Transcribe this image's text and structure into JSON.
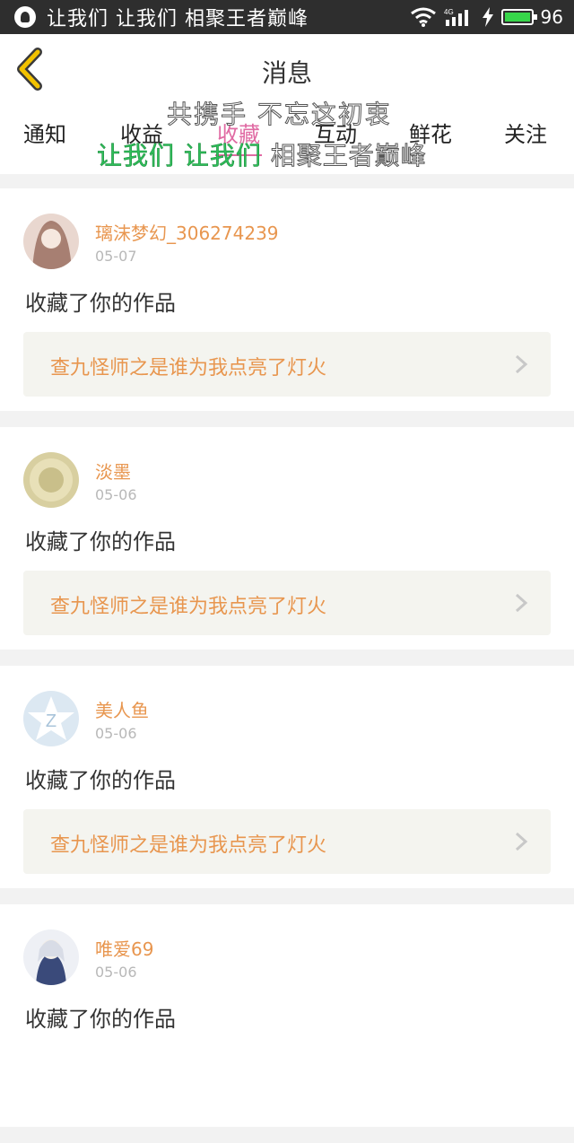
{
  "status_bar": {
    "carrier": "让我们 让我们 相聚王者巅峰",
    "battery_level": "96",
    "network": "4G",
    "colors": {
      "background": "#2e2e2e",
      "battery": "#37d64a"
    }
  },
  "header": {
    "title": "消息",
    "back_icon": "chevron-left-icon",
    "accent": "#f2c200"
  },
  "tabs": [
    {
      "label": "通知",
      "active": false
    },
    {
      "label": "收益",
      "active": false
    },
    {
      "label": "收藏",
      "active": true
    },
    {
      "label": "互动",
      "active": false
    },
    {
      "label": "鲜花",
      "active": false
    },
    {
      "label": "关注",
      "active": false
    }
  ],
  "watermark": {
    "line1": "共携手 不忘这初衷",
    "line2_green": "让我们 让我们",
    "line2_white": " 相聚王者巅峰"
  },
  "messages": [
    {
      "username": "璃沫梦幻_306274239",
      "date": "05-07",
      "action": "收藏了你的作品",
      "work_title": "查九怪师之是谁为我点亮了灯火"
    },
    {
      "username": "淡墨",
      "date": "05-06",
      "action": "收藏了你的作品",
      "work_title": "查九怪师之是谁为我点亮了灯火"
    },
    {
      "username": "美人鱼",
      "date": "05-06",
      "action": "收藏了你的作品",
      "work_title": "查九怪师之是谁为我点亮了灯火"
    },
    {
      "username": "唯爱69",
      "date": "05-06",
      "action": "收藏了你的作品",
      "work_title": ""
    }
  ],
  "colors": {
    "accent_orange": "#e8964f",
    "tab_active": "#e06aa3",
    "card_inner": "#f4f4ef"
  }
}
